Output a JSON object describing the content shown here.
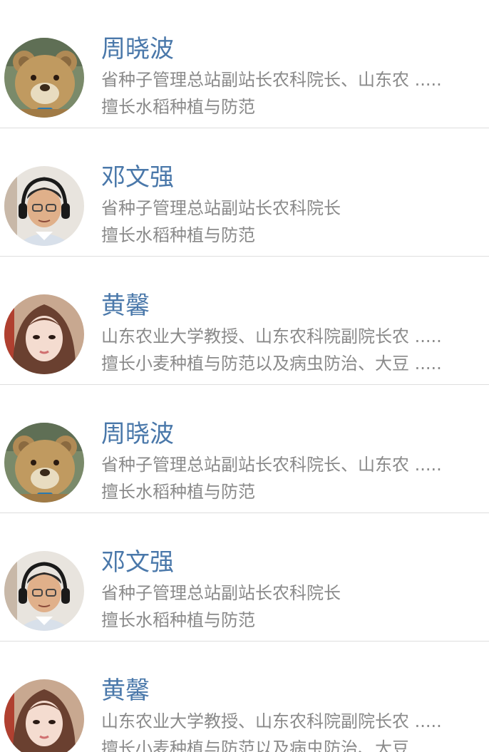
{
  "experts": [
    {
      "name": "周晓波",
      "title": "省种子管理总站副站长农科院长、山东农 .....",
      "specialty": "擅长水稻种植与防范",
      "avatar": "teddy-bear-avatar"
    },
    {
      "name": "邓文强",
      "title": "省种子管理总站副站长农科院长",
      "specialty": "擅长水稻种植与防范",
      "avatar": "man-headphones-avatar"
    },
    {
      "name": "黄馨",
      "title": "山东农业大学教授、山东农科院副院长农 .....",
      "specialty": "擅长小麦种植与防范以及病虫防治、大豆 .....",
      "avatar": "woman-avatar"
    },
    {
      "name": "周晓波",
      "title": "省种子管理总站副站长农科院长、山东农 .....",
      "specialty": "擅长水稻种植与防范",
      "avatar": "teddy-bear-avatar"
    },
    {
      "name": "邓文强",
      "title": "省种子管理总站副站长农科院长",
      "specialty": "擅长水稻种植与防范",
      "avatar": "man-headphones-avatar"
    },
    {
      "name": "黄馨",
      "title": "山东农业大学教授、山东农科院副院长农 .....",
      "specialty": "擅长小麦种植与防范以及病虫防治、大豆",
      "avatar": "woman-avatar"
    }
  ],
  "colors": {
    "name": "#4a78aa",
    "detail": "#8a8a8a",
    "divider": "#dedede",
    "background": "#ffffff"
  }
}
